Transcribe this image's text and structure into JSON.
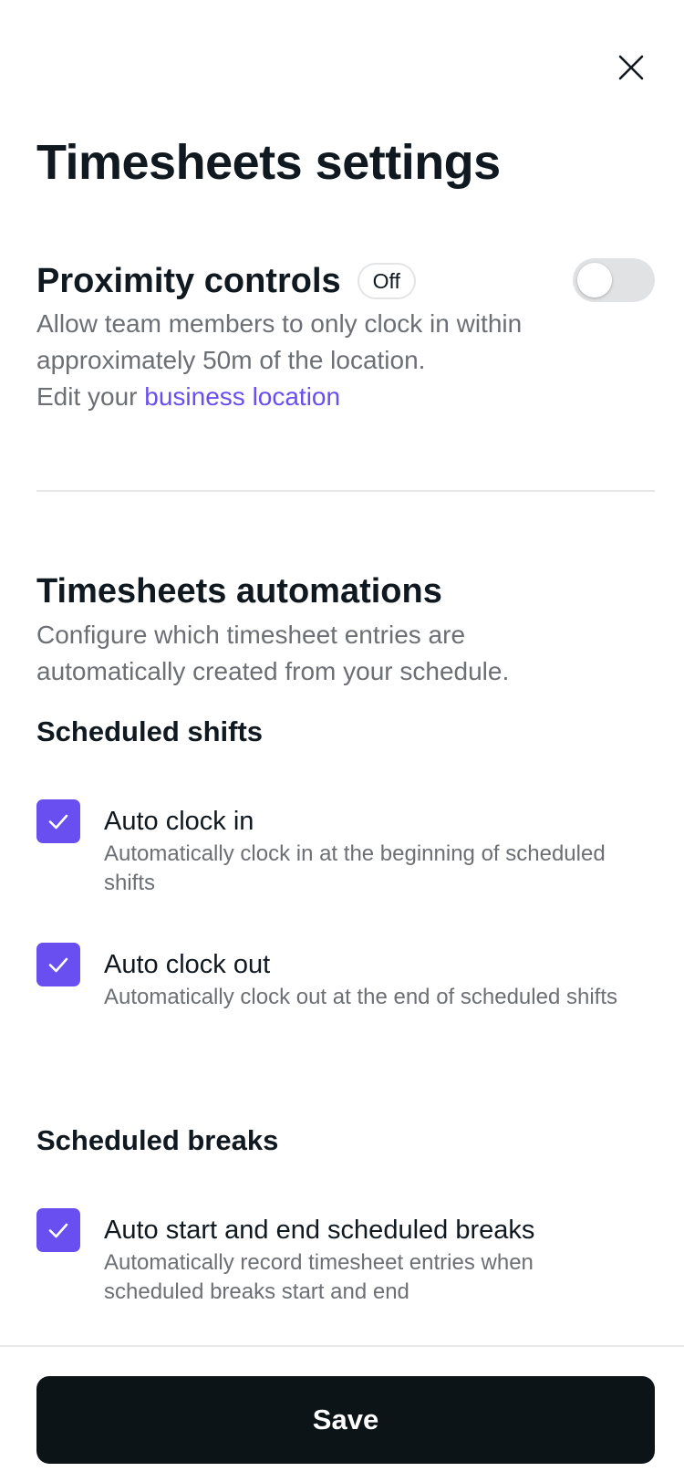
{
  "page": {
    "title": "Timesheets settings"
  },
  "proximity": {
    "heading": "Proximity controls",
    "status": "Off",
    "enabled": false,
    "description_line": "Allow team members to only clock in within approximately 50m of the location.",
    "edit_prefix": "Edit your ",
    "edit_link": "business location"
  },
  "automations": {
    "heading": "Timesheets automations",
    "description": "Configure which timesheet entries are automatically created from your schedule.",
    "scheduled_shifts": {
      "heading": "Scheduled shifts",
      "options": [
        {
          "label": "Auto clock in",
          "description": "Automatically clock in at the beginning of scheduled shifts",
          "checked": true
        },
        {
          "label": "Auto clock out",
          "description": "Automatically clock out at the end of scheduled shifts",
          "checked": true
        }
      ]
    },
    "scheduled_breaks": {
      "heading": "Scheduled breaks",
      "options": [
        {
          "label": "Auto start and end scheduled breaks",
          "description": "Automatically record timesheet entries when scheduled breaks start and end",
          "checked": true
        }
      ]
    }
  },
  "footer": {
    "save_label": "Save"
  },
  "colors": {
    "accent": "#6a4ff0",
    "primary_button": "#0d1417",
    "toggle_off": "#e1e2e4",
    "muted_text": "#6c6f74"
  },
  "icons": {
    "close": "close-icon",
    "check": "checkmark-icon"
  }
}
